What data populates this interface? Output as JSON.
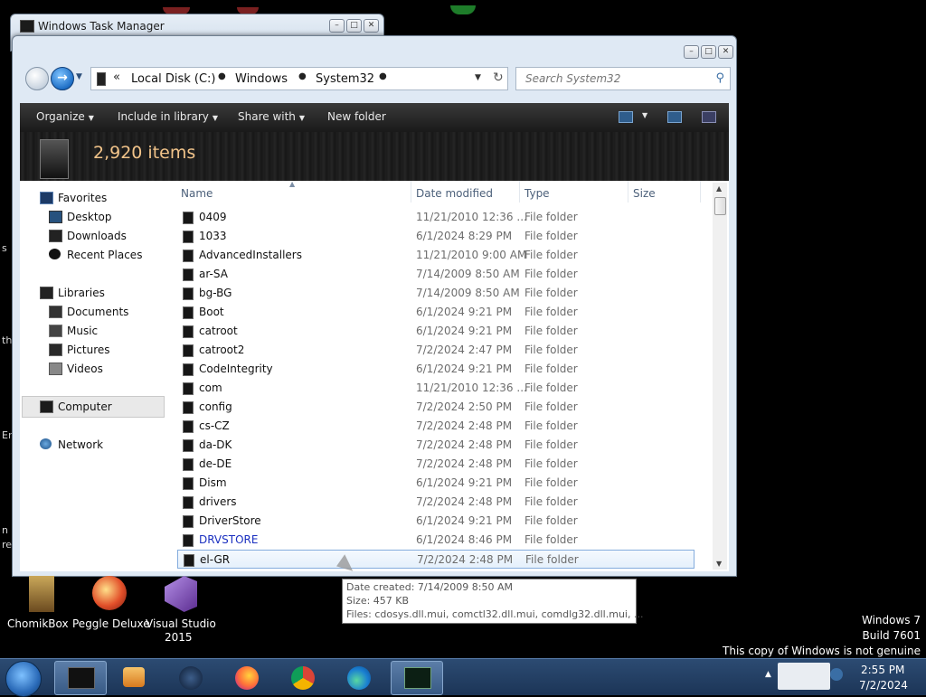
{
  "task_manager": {
    "title": "Windows Task Manager",
    "controls": [
      "–",
      "□",
      "✕"
    ]
  },
  "explorer": {
    "controls": [
      "–",
      "□",
      "✕"
    ],
    "breadcrumb": {
      "chevron": "«",
      "items": [
        "Local Disk (C:)",
        "Windows",
        "System32"
      ]
    },
    "search_placeholder": "Search System32",
    "toolbar": {
      "organize": "Organize",
      "include_in_library": "Include in library",
      "share_with": "Share with",
      "new_folder": "New folder"
    },
    "items_count": "2,920 items",
    "nav": {
      "favorites": "Favorites",
      "desktop": "Desktop",
      "downloads": "Downloads",
      "recent_places": "Recent Places",
      "libraries": "Libraries",
      "documents": "Documents",
      "music": "Music",
      "pictures": "Pictures",
      "videos": "Videos",
      "computer": "Computer",
      "network": "Network"
    },
    "columns": {
      "name": "Name",
      "date_modified": "Date modified",
      "type": "Type",
      "size": "Size"
    },
    "rows": [
      {
        "name": "0409",
        "date": "11/21/2010 12:36 ...",
        "type": "File folder"
      },
      {
        "name": "1033",
        "date": "6/1/2024 8:29 PM",
        "type": "File folder"
      },
      {
        "name": "AdvancedInstallers",
        "date": "11/21/2010 9:00 AM",
        "type": "File folder"
      },
      {
        "name": "ar-SA",
        "date": "7/14/2009 8:50 AM",
        "type": "File folder"
      },
      {
        "name": "bg-BG",
        "date": "7/14/2009 8:50 AM",
        "type": "File folder"
      },
      {
        "name": "Boot",
        "date": "6/1/2024 9:21 PM",
        "type": "File folder"
      },
      {
        "name": "catroot",
        "date": "6/1/2024 9:21 PM",
        "type": "File folder"
      },
      {
        "name": "catroot2",
        "date": "7/2/2024 2:47 PM",
        "type": "File folder"
      },
      {
        "name": "CodeIntegrity",
        "date": "6/1/2024 9:21 PM",
        "type": "File folder"
      },
      {
        "name": "com",
        "date": "11/21/2010 12:36 ...",
        "type": "File folder"
      },
      {
        "name": "config",
        "date": "7/2/2024 2:50 PM",
        "type": "File folder"
      },
      {
        "name": "cs-CZ",
        "date": "7/2/2024 2:48 PM",
        "type": "File folder"
      },
      {
        "name": "da-DK",
        "date": "7/2/2024 2:48 PM",
        "type": "File folder"
      },
      {
        "name": "de-DE",
        "date": "7/2/2024 2:48 PM",
        "type": "File folder"
      },
      {
        "name": "Dism",
        "date": "6/1/2024 9:21 PM",
        "type": "File folder"
      },
      {
        "name": "drivers",
        "date": "7/2/2024 2:48 PM",
        "type": "File folder"
      },
      {
        "name": "DriverStore",
        "date": "6/1/2024 9:21 PM",
        "type": "File folder"
      },
      {
        "name": "DRVSTORE",
        "date": "6/1/2024 8:46 PM",
        "type": "File folder"
      },
      {
        "name": "el-GR",
        "date": "7/2/2024 2:48 PM",
        "type": "File folder"
      }
    ],
    "tooltip": {
      "date_created": "Date created: 7/14/2009 8:50 AM",
      "size": "Size: 457 KB",
      "files": "Files: cdosys.dll.mui, comctl32.dll.mui, comdlg32.dll.mui, ..."
    }
  },
  "desktop": {
    "left_edge_fragments": [
      "s",
      "th",
      "En",
      "n",
      "re"
    ],
    "icons": {
      "chomikbox": "ChomikBox",
      "peggle": "Peggle Deluxe",
      "vs_line1": "Visual Studio",
      "vs_line2": "2015"
    },
    "watermark": {
      "line1": "Windows 7",
      "line2": "Build 7601",
      "line3": "This copy of Windows is not genuine"
    }
  },
  "taskbar": {
    "clock_time": "2:55 PM",
    "clock_date": "7/2/2024"
  }
}
